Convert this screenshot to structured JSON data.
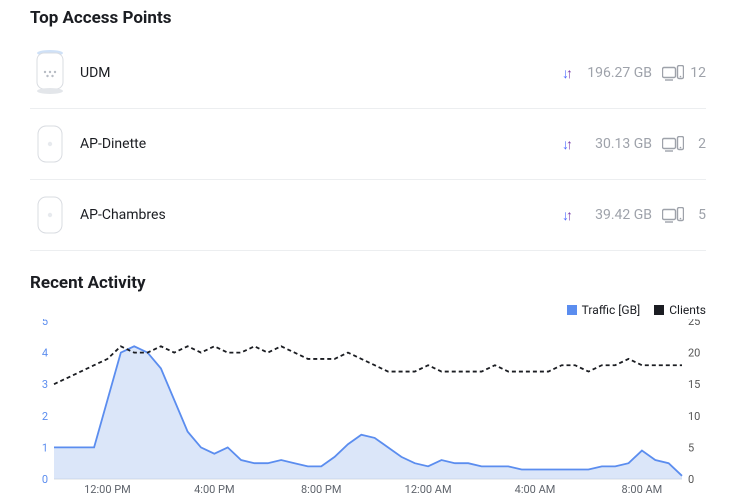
{
  "top_aps": {
    "title": "Top Access Points",
    "rows": [
      {
        "name": "UDM",
        "traffic": "196.27 GB",
        "clients": "12",
        "device": "udm"
      },
      {
        "name": "AP-Dinette",
        "traffic": "30.13 GB",
        "clients": "2",
        "device": "uap"
      },
      {
        "name": "AP-Chambres",
        "traffic": "39.42 GB",
        "clients": "5",
        "device": "uap"
      }
    ]
  },
  "recent": {
    "title": "Recent Activity",
    "legend_traffic": "Traffic [GB]",
    "legend_clients": "Clients"
  },
  "chart_data": {
    "type": "line",
    "x_ticks": [
      "12:00 PM",
      "4:00 PM",
      "8:00 PM",
      "12:00 AM",
      "4:00 AM",
      "8:00 AM"
    ],
    "y_left": {
      "label": "Traffic [GB]",
      "min": 0,
      "max": 5,
      "ticks": [
        0,
        1,
        2,
        3,
        4,
        5
      ]
    },
    "y_right": {
      "label": "Clients",
      "min": 0,
      "max": 25,
      "ticks": [
        0,
        5,
        10,
        15,
        20,
        25
      ]
    },
    "series": [
      {
        "name": "Traffic [GB]",
        "axis": "left",
        "style": "area-line",
        "color": "#5b8def",
        "values": [
          1.0,
          1.0,
          1.0,
          1.0,
          2.5,
          4.0,
          4.2,
          4.0,
          3.5,
          2.5,
          1.5,
          1.0,
          0.8,
          1.0,
          0.6,
          0.5,
          0.5,
          0.6,
          0.5,
          0.4,
          0.4,
          0.7,
          1.1,
          1.4,
          1.3,
          1.0,
          0.7,
          0.5,
          0.4,
          0.6,
          0.5,
          0.5,
          0.4,
          0.4,
          0.4,
          0.3,
          0.3,
          0.3,
          0.3,
          0.3,
          0.3,
          0.4,
          0.4,
          0.5,
          0.9,
          0.6,
          0.5,
          0.1
        ]
      },
      {
        "name": "Clients",
        "axis": "right",
        "style": "dashed-line",
        "color": "#1b1d22",
        "values": [
          15,
          16,
          17,
          18,
          19,
          21,
          20,
          20,
          21,
          20,
          21,
          20,
          21,
          20,
          20,
          21,
          20,
          21,
          20,
          19,
          19,
          19,
          20,
          19,
          18,
          17,
          17,
          17,
          18,
          17,
          17,
          17,
          17,
          18,
          17,
          17,
          17,
          17,
          18,
          18,
          17,
          18,
          18,
          19,
          18,
          18,
          18,
          18
        ]
      }
    ]
  }
}
